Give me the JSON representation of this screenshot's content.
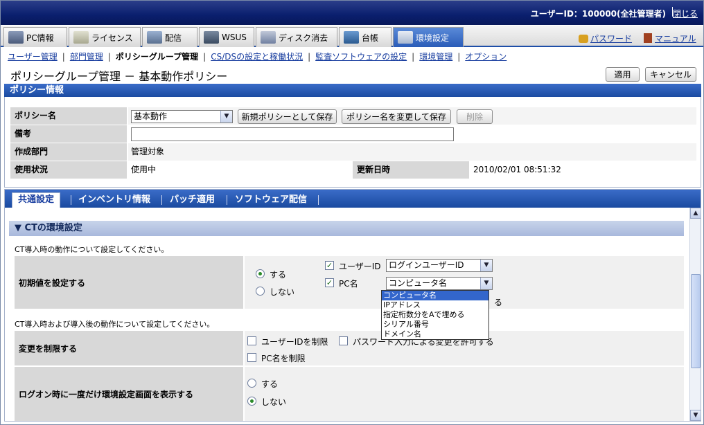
{
  "topbar": {
    "user": "ユーザーID：100000(全社管理者)",
    "close": "閉じる"
  },
  "main_tabs": [
    {
      "label": "PC情報",
      "icon": "pc-icon"
    },
    {
      "label": "ライセンス",
      "icon": "license-icon"
    },
    {
      "label": "配信",
      "icon": "delivery-icon"
    },
    {
      "label": "WSUS",
      "icon": "wsus-icon"
    },
    {
      "label": "ディスク消去",
      "icon": "disk-erase-icon"
    },
    {
      "label": "台帳",
      "icon": "ledger-icon"
    },
    {
      "label": "環境設定",
      "icon": "tools-icon"
    }
  ],
  "top_links": {
    "password": "パスワード",
    "manual": "マニュアル"
  },
  "subnav": [
    "ユーザー管理",
    "部門管理",
    "ポリシーグループ管理",
    "CS/DSの設定と稼働状況",
    "監査ソフトウェアの設定",
    "環境管理",
    "オプション"
  ],
  "page": {
    "title": "ポリシーグループ管理 － 基本動作ポリシー",
    "apply": "適用",
    "cancel": "キャンセル"
  },
  "policy_info": {
    "header": "ポリシー情報",
    "name_label": "ポリシー名",
    "name_value": "基本動作",
    "save_new": "新規ポリシーとして保存",
    "save_rename": "ポリシー名を変更して保存",
    "delete": "削除",
    "memo_label": "備考",
    "memo_value": "",
    "dept_label": "作成部門",
    "dept_value": "管理対象",
    "status_label": "使用状況",
    "status_value": "使用中",
    "updated_label": "更新日時",
    "updated_value": "2010/02/01 08:51:32"
  },
  "sub_tabs": [
    "共通設定",
    "インベントリ情報",
    "パッチ適用",
    "ソフトウェア配信"
  ],
  "ct": {
    "header": "▼ CTの環境設定",
    "note1": "CT導入時の動作について設定してください。",
    "initial_label": "初期値を設定する",
    "yes": "する",
    "no": "しない",
    "userid_label": "ユーザーID",
    "userid_value": "ログインユーザーID",
    "pcname_label": "PC名",
    "pcname_value": "コンピュータ名",
    "hidden_suffix": "る",
    "note2": "CT導入時および導入後の動作について設定してください。",
    "restrict_label": "変更を制限する",
    "restrict_userid": "ユーザーIDを制限",
    "restrict_password": "パスワード入力による変更を許可する",
    "restrict_pcname": "PC名を制限",
    "logon_label": "ログオン時に一度だけ環境設定画面を表示する",
    "logon_yes": "する",
    "logon_no": "しない"
  },
  "dropdown_options": [
    "コンピュータ名",
    "IPアドレス",
    "指定桁数分をAで埋める",
    "シリアル番号",
    "ドメイン名"
  ],
  "colors": {
    "accent": "#1a4aa0",
    "link": "#1a3fa0",
    "selected_option": "#3366cc"
  }
}
